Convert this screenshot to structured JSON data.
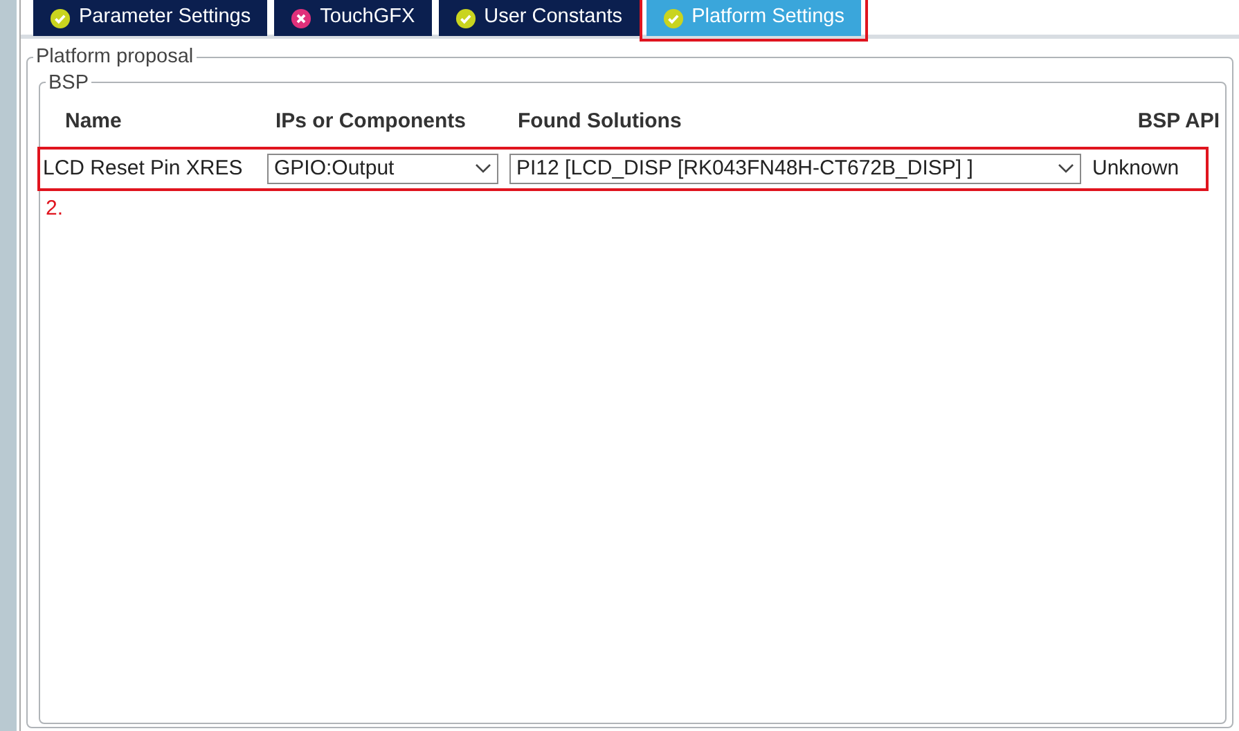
{
  "tabs": [
    {
      "label": "Parameter Settings",
      "kind": "ok",
      "selected": false,
      "highlighted": false
    },
    {
      "label": "TouchGFX",
      "kind": "error",
      "selected": false,
      "highlighted": false
    },
    {
      "label": "User Constants",
      "kind": "ok",
      "selected": false,
      "highlighted": false
    },
    {
      "label": "Platform Settings",
      "kind": "ok",
      "selected": true,
      "highlighted": true
    }
  ],
  "platform_proposal": {
    "title": "Platform proposal",
    "bsp": {
      "title": "BSP",
      "columns": [
        "Name",
        "IPs or Components",
        "Found Solutions",
        "BSP API"
      ],
      "rows": [
        {
          "name": "LCD Reset Pin XRES",
          "component": "GPIO:Output",
          "solution": "PI12 [LCD_DISP [RK043FN48H-CT672B_DISP] ]",
          "api": "Unknown",
          "highlighted": true
        }
      ],
      "annotation": "2."
    }
  }
}
